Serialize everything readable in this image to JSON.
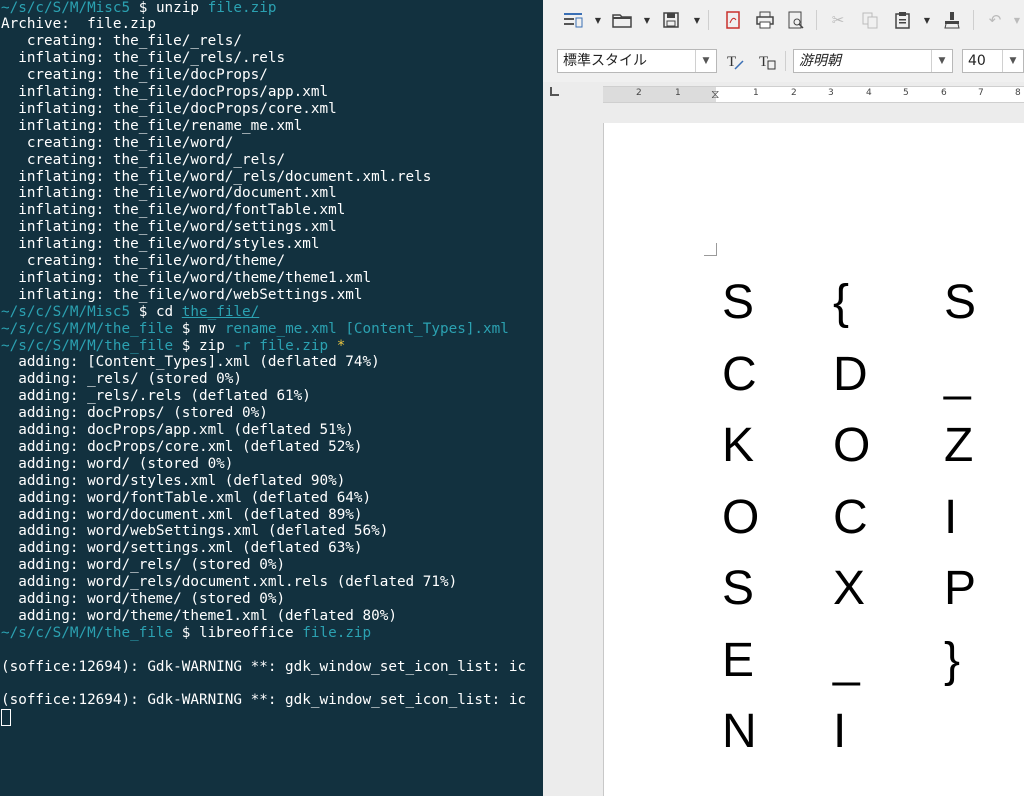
{
  "terminal": {
    "lines": [
      {
        "segs": [
          {
            "t": "~/s/c/S/M/Misc5",
            "c": "prompt"
          },
          {
            "t": " $ ",
            "c": "tl-dollar"
          },
          {
            "t": "unzip ",
            "c": "tl-cmd"
          },
          {
            "t": "file.zip",
            "c": "tl-arg"
          }
        ]
      },
      {
        "segs": [
          {
            "t": "Archive:  file.zip",
            "c": ""
          }
        ]
      },
      {
        "segs": [
          {
            "t": "   creating: the_file/_rels/",
            "c": ""
          }
        ]
      },
      {
        "segs": [
          {
            "t": "  inflating: the_file/_rels/.rels",
            "c": ""
          }
        ]
      },
      {
        "segs": [
          {
            "t": "   creating: the_file/docProps/",
            "c": ""
          }
        ]
      },
      {
        "segs": [
          {
            "t": "  inflating: the_file/docProps/app.xml",
            "c": ""
          }
        ]
      },
      {
        "segs": [
          {
            "t": "  inflating: the_file/docProps/core.xml",
            "c": ""
          }
        ]
      },
      {
        "segs": [
          {
            "t": "  inflating: the_file/rename_me.xml",
            "c": ""
          }
        ]
      },
      {
        "segs": [
          {
            "t": "   creating: the_file/word/",
            "c": ""
          }
        ]
      },
      {
        "segs": [
          {
            "t": "   creating: the_file/word/_rels/",
            "c": ""
          }
        ]
      },
      {
        "segs": [
          {
            "t": "  inflating: the_file/word/_rels/document.xml.rels",
            "c": ""
          }
        ]
      },
      {
        "segs": [
          {
            "t": "  inflating: the_file/word/document.xml",
            "c": ""
          }
        ]
      },
      {
        "segs": [
          {
            "t": "  inflating: the_file/word/fontTable.xml",
            "c": ""
          }
        ]
      },
      {
        "segs": [
          {
            "t": "  inflating: the_file/word/settings.xml",
            "c": ""
          }
        ]
      },
      {
        "segs": [
          {
            "t": "  inflating: the_file/word/styles.xml",
            "c": ""
          }
        ]
      },
      {
        "segs": [
          {
            "t": "   creating: the_file/word/theme/",
            "c": ""
          }
        ]
      },
      {
        "segs": [
          {
            "t": "  inflating: the_file/word/theme/theme1.xml",
            "c": ""
          }
        ]
      },
      {
        "segs": [
          {
            "t": "  inflating: the_file/word/webSettings.xml",
            "c": ""
          }
        ]
      },
      {
        "segs": [
          {
            "t": "~/s/c/S/M/Misc5",
            "c": "prompt"
          },
          {
            "t": " $ ",
            "c": "tl-dollar"
          },
          {
            "t": "cd ",
            "c": "tl-cmd"
          },
          {
            "t": "the_file/",
            "c": "tl-argu"
          }
        ]
      },
      {
        "segs": [
          {
            "t": "~/s/c/S/M/M/the_file",
            "c": "prompt"
          },
          {
            "t": " $ ",
            "c": "tl-dollar"
          },
          {
            "t": "mv ",
            "c": "tl-cmd"
          },
          {
            "t": "rename_me.xml [Content_Types].xml",
            "c": "tl-arg"
          }
        ]
      },
      {
        "segs": [
          {
            "t": "~/s/c/S/M/M/the_file",
            "c": "prompt"
          },
          {
            "t": " $ ",
            "c": "tl-dollar"
          },
          {
            "t": "zip ",
            "c": "tl-cmd"
          },
          {
            "t": "-r file.zip ",
            "c": "tl-arg"
          },
          {
            "t": "*",
            "c": "tl-star"
          }
        ]
      },
      {
        "segs": [
          {
            "t": "  adding: [Content_Types].xml (deflated 74%)",
            "c": ""
          }
        ]
      },
      {
        "segs": [
          {
            "t": "  adding: _rels/ (stored 0%)",
            "c": ""
          }
        ]
      },
      {
        "segs": [
          {
            "t": "  adding: _rels/.rels (deflated 61%)",
            "c": ""
          }
        ]
      },
      {
        "segs": [
          {
            "t": "  adding: docProps/ (stored 0%)",
            "c": ""
          }
        ]
      },
      {
        "segs": [
          {
            "t": "  adding: docProps/app.xml (deflated 51%)",
            "c": ""
          }
        ]
      },
      {
        "segs": [
          {
            "t": "  adding: docProps/core.xml (deflated 52%)",
            "c": ""
          }
        ]
      },
      {
        "segs": [
          {
            "t": "  adding: word/ (stored 0%)",
            "c": ""
          }
        ]
      },
      {
        "segs": [
          {
            "t": "  adding: word/styles.xml (deflated 90%)",
            "c": ""
          }
        ]
      },
      {
        "segs": [
          {
            "t": "  adding: word/fontTable.xml (deflated 64%)",
            "c": ""
          }
        ]
      },
      {
        "segs": [
          {
            "t": "  adding: word/document.xml (deflated 89%)",
            "c": ""
          }
        ]
      },
      {
        "segs": [
          {
            "t": "  adding: word/webSettings.xml (deflated 56%)",
            "c": ""
          }
        ]
      },
      {
        "segs": [
          {
            "t": "  adding: word/settings.xml (deflated 63%)",
            "c": ""
          }
        ]
      },
      {
        "segs": [
          {
            "t": "  adding: word/_rels/ (stored 0%)",
            "c": ""
          }
        ]
      },
      {
        "segs": [
          {
            "t": "  adding: word/_rels/document.xml.rels (deflated 71%)",
            "c": ""
          }
        ]
      },
      {
        "segs": [
          {
            "t": "  adding: word/theme/ (stored 0%)",
            "c": ""
          }
        ]
      },
      {
        "segs": [
          {
            "t": "  adding: word/theme/theme1.xml (deflated 80%)",
            "c": ""
          }
        ]
      },
      {
        "segs": [
          {
            "t": "~/s/c/S/M/M/the_file",
            "c": "prompt"
          },
          {
            "t": " $ ",
            "c": "tl-dollar"
          },
          {
            "t": "libreoffice ",
            "c": "tl-cmd"
          },
          {
            "t": "file.zip",
            "c": "tl-arg"
          }
        ]
      },
      {
        "segs": [
          {
            "t": "",
            "c": ""
          }
        ]
      },
      {
        "segs": [
          {
            "t": "(soffice:12694): Gdk-WARNING **: gdk_window_set_icon_list: ic",
            "c": ""
          }
        ]
      },
      {
        "segs": [
          {
            "t": "",
            "c": ""
          }
        ]
      },
      {
        "segs": [
          {
            "t": "(soffice:12694): Gdk-WARNING **: gdk_window_set_icon_list: ic",
            "c": ""
          }
        ]
      }
    ]
  },
  "writer": {
    "paragraph_style": "標準スタイル",
    "font_name": "游明朝",
    "font_size": "40",
    "ruler_numbers": [
      "2",
      "1",
      "1",
      "2",
      "3",
      "4",
      "5",
      "6",
      "7",
      "8"
    ]
  },
  "document": {
    "columns": [
      [
        "S",
        "C",
        "K",
        "O",
        "S",
        "E",
        "N"
      ],
      [
        "{",
        "D",
        "O",
        "C",
        "X",
        "_",
        "I"
      ],
      [
        "S",
        "_",
        "Z",
        "I",
        "P",
        "}"
      ]
    ]
  }
}
